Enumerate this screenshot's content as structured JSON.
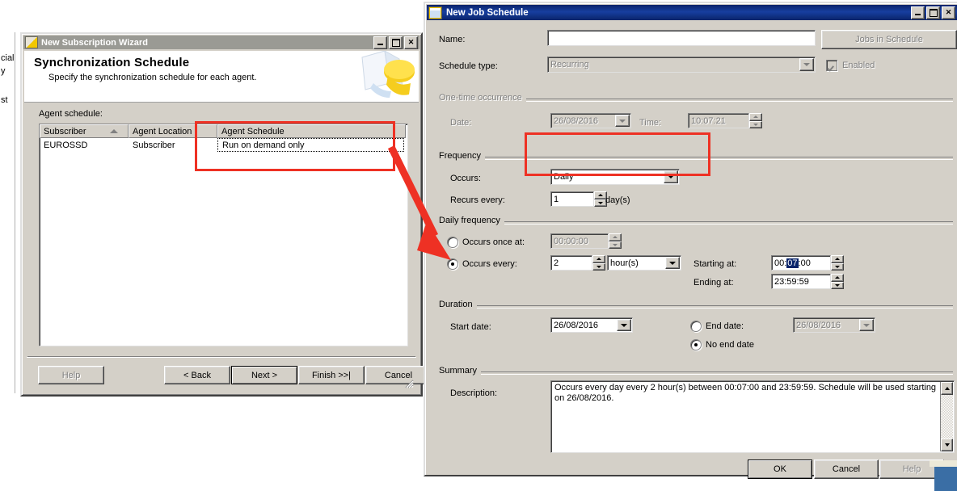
{
  "desktop": {
    "left_fragments": [
      "cial",
      "y",
      "st"
    ]
  },
  "wizard": {
    "title": "New Subscription Wizard",
    "title_icon": "wizard-icon",
    "heading": "Synchronization Schedule",
    "subheading": "Specify the synchronization schedule for each agent.",
    "agent_schedule_label": "Agent schedule:",
    "grid": {
      "columns": [
        "Subscriber",
        "Agent Location",
        "Agent Schedule"
      ],
      "sort_column": "Subscriber",
      "rows": [
        [
          "EUROSSD",
          "Subscriber",
          "Run on demand only"
        ]
      ]
    },
    "buttons": {
      "help": "Help",
      "back": "< Back",
      "next": "Next >",
      "finish": "Finish >>|",
      "cancel": "Cancel"
    },
    "window_controls": {
      "minimize": "_",
      "maximize": "□",
      "close": "✕"
    }
  },
  "job_schedule": {
    "title": "New Job Schedule",
    "title_icon": "schedule-icon",
    "window_controls": {
      "minimize": "_",
      "maximize": "□",
      "close": "✕"
    },
    "name_label": "Name:",
    "name_value": "",
    "jobs_in_schedule_button": "Jobs in Schedule",
    "schedule_type_label": "Schedule type:",
    "schedule_type_value": "Recurring",
    "enabled_label": "Enabled",
    "enabled_checked": true,
    "one_time": {
      "group_label": "One-time occurrence",
      "date_label": "Date:",
      "date_value": "26/08/2016",
      "time_label": "Time:",
      "time_value": "10:07:21"
    },
    "frequency": {
      "group_label": "Frequency",
      "occurs_label": "Occurs:",
      "occurs_value": "Daily",
      "recurs_every_label": "Recurs every:",
      "recurs_every_value": "1",
      "recurs_unit": "day(s)"
    },
    "daily_frequency": {
      "group_label": "Daily frequency",
      "occurs_once_label": "Occurs once at:",
      "occurs_once_value": "00:00:00",
      "occurs_once_selected": false,
      "occurs_every_label": "Occurs every:",
      "occurs_every_selected": true,
      "occurs_every_value": "2",
      "occurs_every_unit": "hour(s)",
      "starting_at_label": "Starting at:",
      "starting_at_prefix": "00:",
      "starting_at_selected_text": "07",
      "starting_at_suffix": ":00",
      "ending_at_label": "Ending at:",
      "ending_at_value": "23:59:59"
    },
    "duration": {
      "group_label": "Duration",
      "start_date_label": "Start date:",
      "start_date_value": "26/08/2016",
      "end_date_label": "End date:",
      "end_date_value": "26/08/2016",
      "end_date_selected": false,
      "no_end_date_label": "No end date",
      "no_end_date_selected": true
    },
    "summary": {
      "group_label": "Summary",
      "description_label": "Description:",
      "description_value": "Occurs every day every 2 hour(s) between 00:07:00 and 23:59:59. Schedule will be used starting on 26/08/2016."
    },
    "buttons": {
      "ok": "OK",
      "cancel": "Cancel",
      "help": "Help"
    }
  },
  "annotations": {
    "accent_color": "#ee3124",
    "highlight_boxes": [
      "agent-schedule-column",
      "occurs-daily-combo"
    ],
    "arrow": "agent-schedule-to-occurs"
  }
}
